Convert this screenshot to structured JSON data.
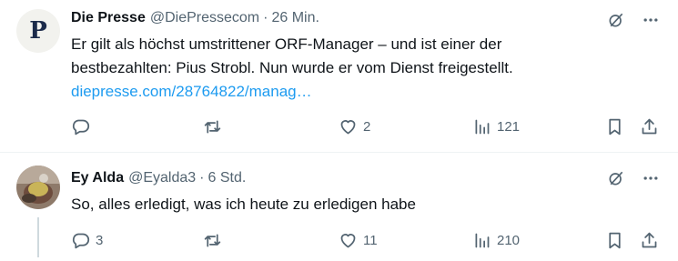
{
  "tweets": [
    {
      "author_name": "Die Presse",
      "handle": "@DiePressecom",
      "separator": "·",
      "time": "26 Min.",
      "avatar_letter": "P",
      "text_line1": "Er gilt als höchst umstrittener ORF-Manager – und ist einer der",
      "text_line2": "bestbezahlten: Pius Strobl. Nun wurde er vom Dienst freigestellt.",
      "link_text": "diepresse.com/28764822/manag…",
      "reply_count": "",
      "retweet_count": "",
      "like_count": "2",
      "view_count": "121"
    },
    {
      "author_name": "Ey Alda",
      "handle": "@Eyalda3",
      "separator": "·",
      "time": "6 Std.",
      "text_line1": "So, alles erledigt, was ich heute zu erledigen habe",
      "reply_count": "3",
      "retweet_count": "",
      "like_count": "11",
      "view_count": "210"
    }
  ],
  "icons": {
    "grok": "grok-icon",
    "more": "more-icon",
    "reply": "reply-icon",
    "retweet": "retweet-icon",
    "like": "like-icon",
    "views": "views-icon",
    "bookmark": "bookmark-icon",
    "share": "share-icon"
  },
  "colors": {
    "text": "#0f1419",
    "secondary": "#536471",
    "link": "#1d9bf0",
    "divider": "#eff3f4"
  }
}
